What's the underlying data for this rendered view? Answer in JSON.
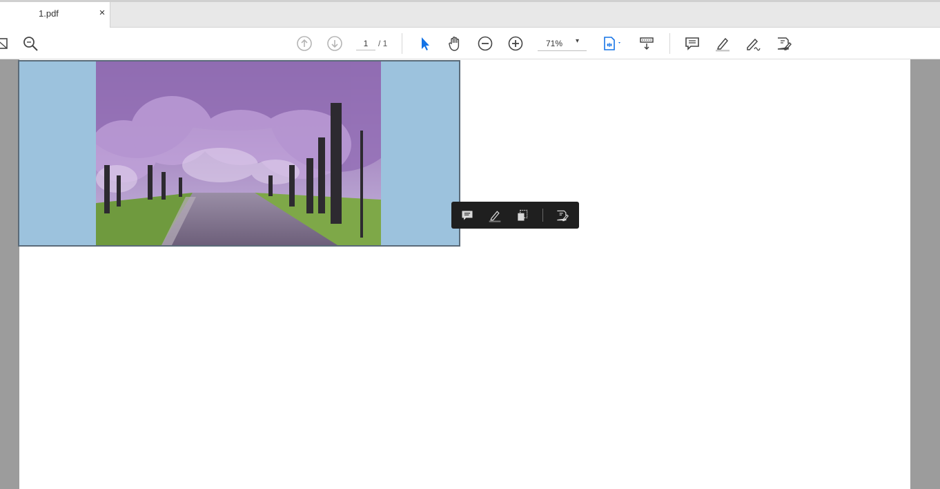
{
  "tab": {
    "title": "1.pdf",
    "close": "×"
  },
  "toolbar": {
    "page_current": "1",
    "page_total": "/ 1",
    "zoom": "71%",
    "zoom_arrow": "▾"
  },
  "icons": {
    "partial_left": "partial-icon",
    "search": "search-icon",
    "prev_page": "arrow-up-circle-icon",
    "next_page": "arrow-down-circle-icon",
    "select": "cursor-arrow-icon",
    "hand": "hand-icon",
    "zoom_out": "minus-circle-icon",
    "zoom_in": "plus-circle-icon",
    "fit": "fit-page-icon",
    "scroll_mode": "scroll-mode-icon",
    "comment": "comment-icon",
    "highlight": "highlight-pen-icon",
    "sign": "sign-pen-icon",
    "fill_sign": "fill-sign-icon"
  },
  "colors": {
    "accent": "#1473e6",
    "image_bg": "#9cc2dd",
    "quick_toolbar": "#1f1f1f"
  }
}
